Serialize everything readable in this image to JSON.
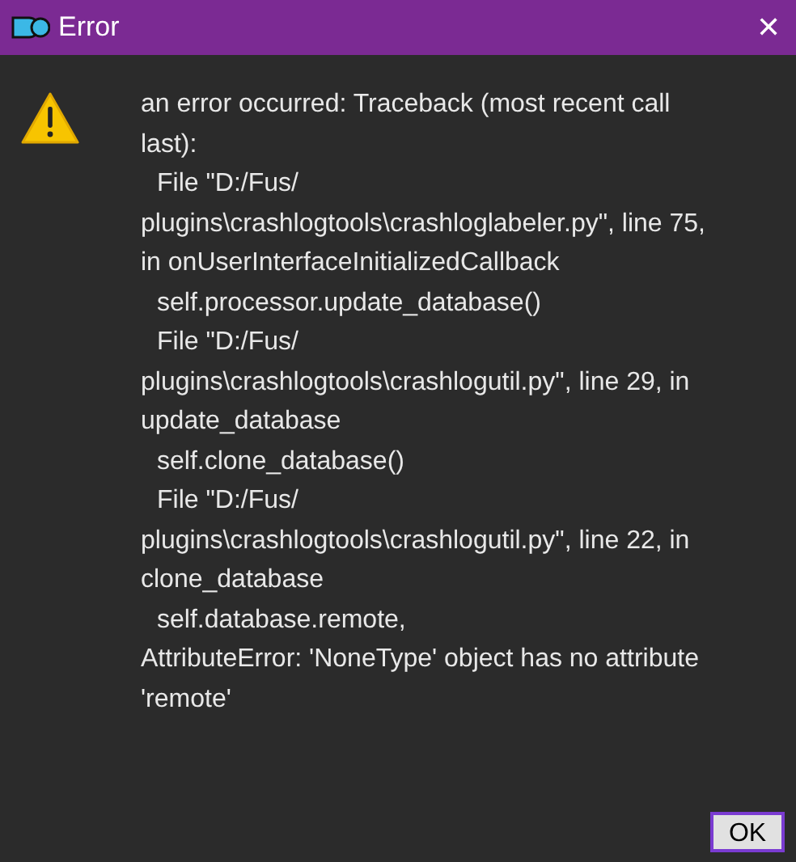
{
  "window": {
    "title": "Error",
    "close": "✕"
  },
  "message_lines": [
    {
      "text": "an error occurred: Traceback (most recent call",
      "indented": false
    },
    {
      "text": "last):",
      "indented": false
    },
    {
      "text": "File \"D:/Fus/",
      "indented": true
    },
    {
      "text": "plugins\\crashlogtools\\crashloglabeler.py\", line 75,",
      "indented": false
    },
    {
      "text": "in onUserInterfaceInitializedCallback",
      "indented": false
    },
    {
      "text": "self.processor.update_database()",
      "indented": true
    },
    {
      "text": "File \"D:/Fus/",
      "indented": true
    },
    {
      "text": "plugins\\crashlogtools\\crashlogutil.py\", line 29, in",
      "indented": false
    },
    {
      "text": "update_database",
      "indented": false
    },
    {
      "text": "self.clone_database()",
      "indented": true
    },
    {
      "text": "File \"D:/Fus/",
      "indented": true
    },
    {
      "text": "plugins\\crashlogtools\\crashlogutil.py\", line 22, in",
      "indented": false
    },
    {
      "text": "clone_database",
      "indented": false
    },
    {
      "text": "self.database.remote,",
      "indented": true
    },
    {
      "text": "AttributeError: 'NoneType' object has no attribute",
      "indented": false
    },
    {
      "text": "'remote'",
      "indented": false
    }
  ],
  "buttons": [
    {
      "label": "OK"
    }
  ]
}
